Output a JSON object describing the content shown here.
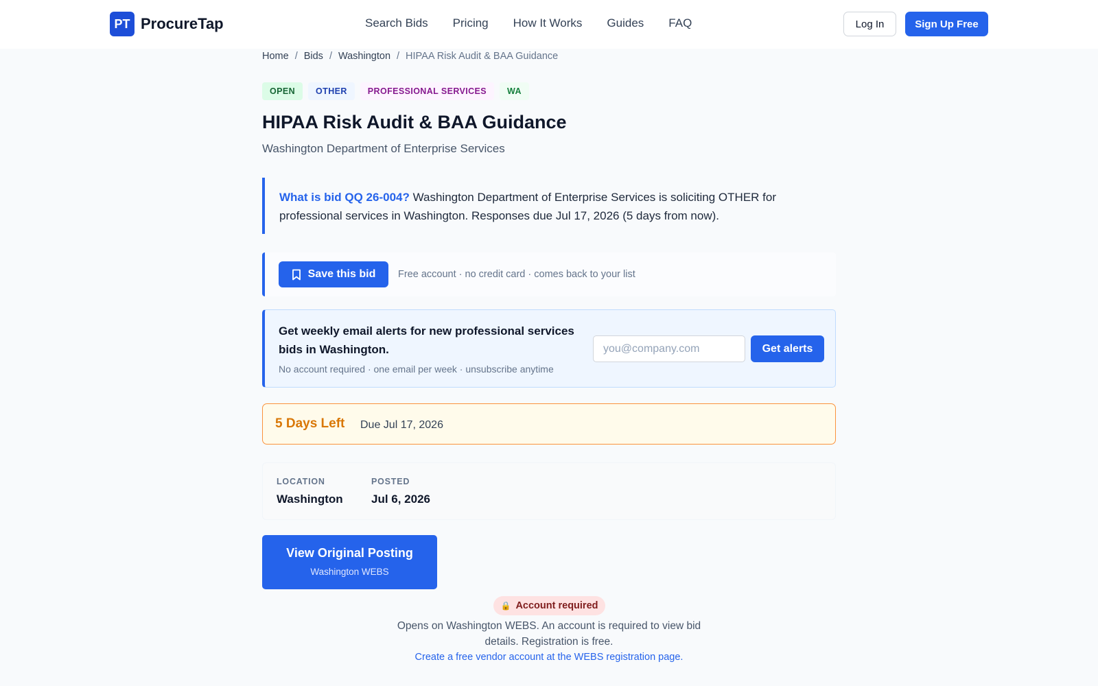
{
  "header": {
    "logo_mark": "PT",
    "logo_text": "ProcureTap",
    "nav": [
      "Search Bids",
      "Pricing",
      "How It Works",
      "Guides",
      "FAQ"
    ],
    "login": "Log In",
    "signup": "Sign Up Free"
  },
  "breadcrumb": {
    "home": "Home",
    "bids": "Bids",
    "state": "Washington",
    "current": "HIPAA Risk Audit & BAA Guidance",
    "separator": "/"
  },
  "tags": {
    "status": "OPEN",
    "type": "OTHER",
    "category": "PROFESSIONAL SERVICES",
    "state": "WA"
  },
  "bid": {
    "title": "HIPAA Risk Audit & BAA Guidance",
    "agency": "Washington Department of Enterprise Services",
    "summary_question": "What is bid QQ 26-004?",
    "summary_text": " Washington Department of Enterprise Services is soliciting OTHER for professional services in Washington. Responses due Jul 17, 2026 (5 days from now)."
  },
  "save": {
    "button": "Save this bid",
    "note": "Free account · no credit card · comes back to your list"
  },
  "alerts": {
    "title": "Get weekly email alerts for new professional services bids in Washington.",
    "note": "No account required · one email per week · unsubscribe anytime",
    "placeholder": "you@company.com",
    "button": "Get alerts"
  },
  "deadline": {
    "days_left": "5 Days Left",
    "due": "Due Jul 17, 2026"
  },
  "meta": {
    "location_label": "LOCATION",
    "location_value": "Washington",
    "posted_label": "POSTED",
    "posted_value": "Jul 6, 2026"
  },
  "posting": {
    "button": "View Original Posting",
    "source": "Washington WEBS",
    "badge": "Account required",
    "note": "Opens on Washington WEBS. An account is required to view bid details. Registration is free.",
    "link": "Create a free vendor account at the WEBS registration page."
  },
  "colors": {
    "primary": "#2563eb",
    "warning": "#d97706",
    "danger_bg": "#fee2e2"
  },
  "icons": {
    "save": "bookmark-icon",
    "badge": "lock-icon"
  }
}
